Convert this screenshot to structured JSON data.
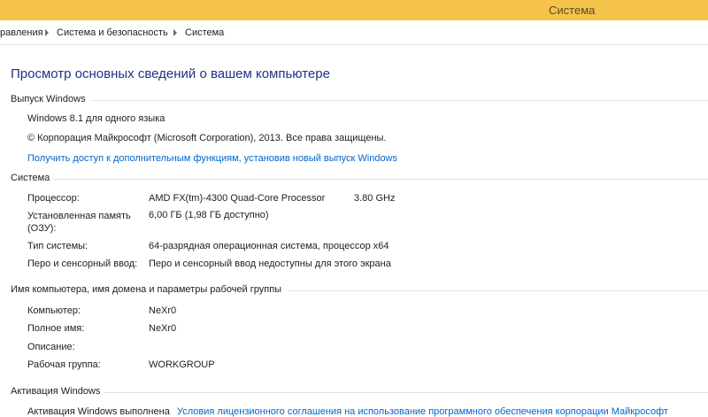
{
  "window": {
    "title": "Система"
  },
  "breadcrumb": {
    "items": [
      "равления",
      "Система и безопасность",
      "Система"
    ]
  },
  "page_title": "Просмотр основных сведений о вашем компьютере",
  "windows_edition": {
    "heading": "Выпуск Windows",
    "edition": "Windows 8.1 для одного языка",
    "copyright": "© Корпорация Майкрософт (Microsoft Corporation), 2013. Все права защищены.",
    "upgrade_link": "Получить доступ к дополнительным функциям, установив новый выпуск Windows"
  },
  "system": {
    "heading": "Система",
    "processor_label": "Процессор:",
    "processor_value": "AMD FX(tm)-4300 Quad-Core Processor",
    "processor_speed": "3.80 GHz",
    "memory_label": "Установленная память (ОЗУ):",
    "memory_value": "6,00 ГБ (1,98 ГБ доступно)",
    "type_label": "Тип системы:",
    "type_value": "64-разрядная операционная система, процессор x64",
    "pen_label": "Перо и сенсорный ввод:",
    "pen_value": "Перо и сенсорный ввод недоступны для этого экрана"
  },
  "computer_name": {
    "heading": "Имя компьютера, имя домена и параметры рабочей группы",
    "computer_label": "Компьютер:",
    "computer_value": "NeXr0",
    "fullname_label": "Полное имя:",
    "fullname_value": "NeXr0",
    "description_label": "Описание:",
    "description_value": "",
    "workgroup_label": "Рабочая группа:",
    "workgroup_value": "WORKGROUP"
  },
  "activation": {
    "heading": "Активация Windows",
    "status": "Активация Windows выполнена",
    "license_link": "Условия лицензионного соглашения на использование программного обеспечения корпорации Майкрософт"
  },
  "colors": {
    "titlebar": "#f5c34a",
    "page_title": "#1e3287",
    "link": "#0066cc"
  }
}
